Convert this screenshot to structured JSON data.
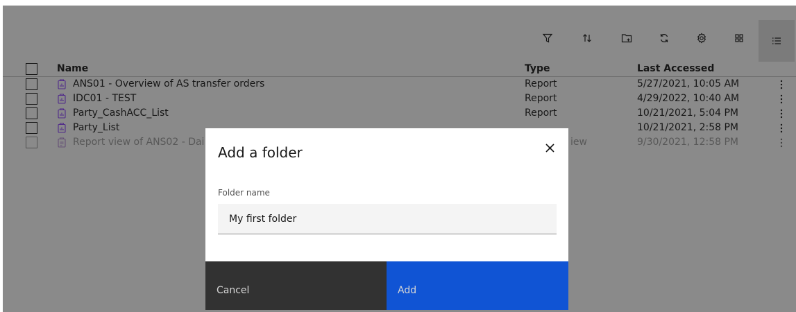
{
  "toolbar": {
    "icons": [
      "filter-icon",
      "sort-icon",
      "new-folder-icon",
      "refresh-icon",
      "settings-icon",
      "grid-view-icon",
      "list-view-icon"
    ]
  },
  "table": {
    "headers": {
      "name": "Name",
      "type": "Type",
      "last_accessed": "Last Accessed"
    },
    "rows": [
      {
        "name": "ANS01 - Overview of AS transfer orders",
        "type": "Report",
        "last_accessed": "5/27/2021, 10:05 AM"
      },
      {
        "name": "IDC01 - TEST",
        "type": "Report",
        "last_accessed": "4/29/2022, 10:40 AM"
      },
      {
        "name": "Party_CashACC_List",
        "type": "Report",
        "last_accessed": "10/21/2021, 5:04 PM"
      },
      {
        "name": "Party_List",
        "type": "",
        "last_accessed": "10/21/2021, 2:58 PM"
      },
      {
        "name": "Report view of ANS02 - Dai",
        "type": "iew",
        "last_accessed": "9/30/2021, 12:58 PM"
      }
    ]
  },
  "modal": {
    "title": "Add a folder",
    "field_label": "Folder name",
    "field_value": "My first folder",
    "cancel_label": "Cancel",
    "add_label": "Add"
  },
  "colors": {
    "primary": "#0f62fe",
    "secondary": "#393939",
    "report_icon": "#8a3ffc"
  }
}
